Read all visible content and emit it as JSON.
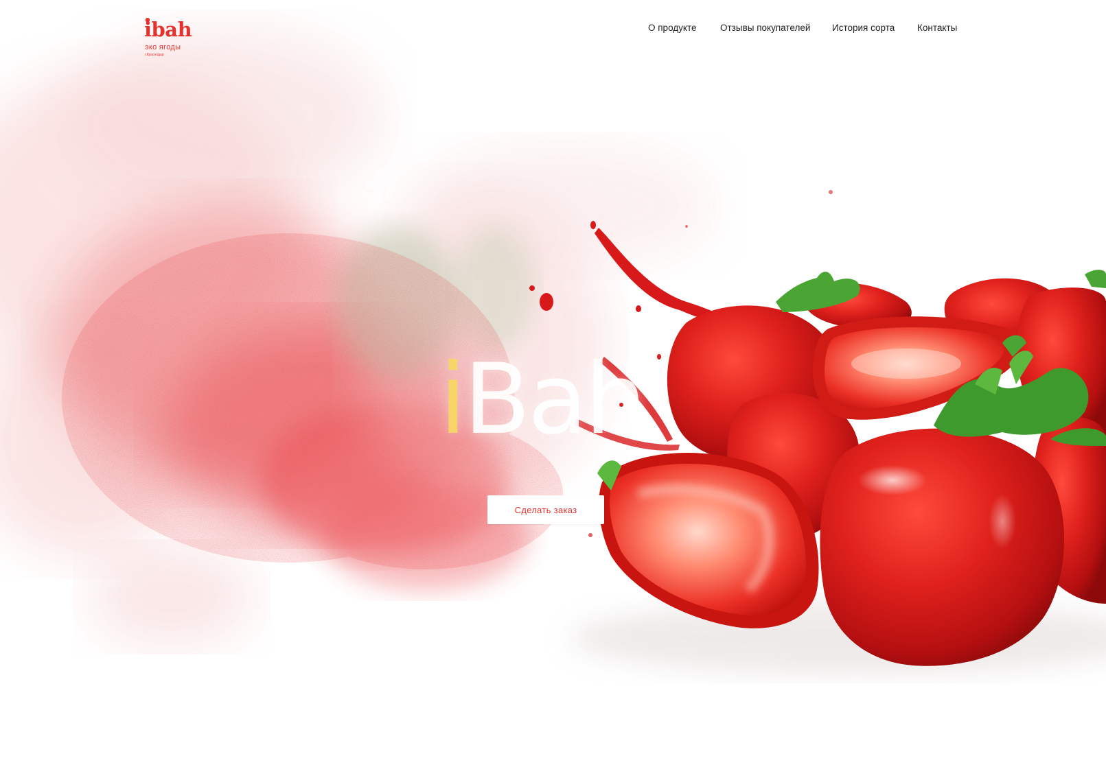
{
  "logo": {
    "word": "ibah",
    "tagline": "эко ягоды",
    "city": "г.Краснодар"
  },
  "nav": {
    "items": [
      {
        "label": "О продукте"
      },
      {
        "label": "Отзывы покупателей"
      },
      {
        "label": "История сорта"
      },
      {
        "label": "Контакты"
      }
    ]
  },
  "hero": {
    "title_first": "i",
    "title_rest": "Bah",
    "cta_label": "Сделать заказ"
  },
  "colors": {
    "brand": "#e6322f",
    "nav_text": "#1e1e1e",
    "background": "#ffffff"
  }
}
